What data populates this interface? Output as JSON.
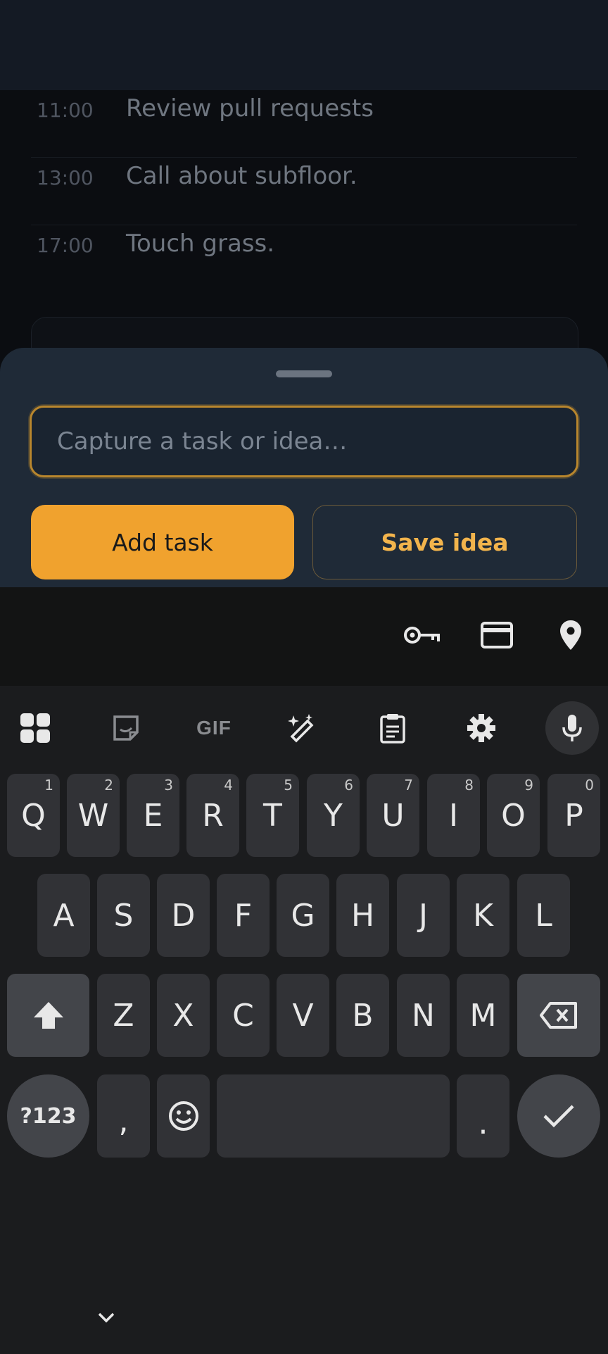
{
  "schedule": [
    {
      "time": "11:00",
      "text": "Review pull requests"
    },
    {
      "time": "13:00",
      "text": "Call about subfloor."
    },
    {
      "time": "17:00",
      "text": "Touch grass."
    }
  ],
  "sheet": {
    "capture_placeholder": "Capture a task or idea…",
    "capture_value": "",
    "add_label": "Add task",
    "save_label": "Save idea"
  },
  "keyboard": {
    "autofill_icons": [
      "key-icon",
      "credit-card-icon",
      "location-pin-icon"
    ],
    "toolbar_icons": [
      "apps-grid-icon",
      "sticker-icon",
      "gif-icon",
      "magic-edit-icon",
      "clipboard-icon",
      "settings-icon",
      "microphone-icon"
    ],
    "gif_label": "GIF",
    "row1": [
      {
        "k": "Q",
        "h": "1"
      },
      {
        "k": "W",
        "h": "2"
      },
      {
        "k": "E",
        "h": "3"
      },
      {
        "k": "R",
        "h": "4"
      },
      {
        "k": "T",
        "h": "5"
      },
      {
        "k": "Y",
        "h": "6"
      },
      {
        "k": "U",
        "h": "7"
      },
      {
        "k": "I",
        "h": "8"
      },
      {
        "k": "O",
        "h": "9"
      },
      {
        "k": "P",
        "h": "0"
      }
    ],
    "row2": [
      "A",
      "S",
      "D",
      "F",
      "G",
      "H",
      "J",
      "K",
      "L"
    ],
    "row3": [
      "Z",
      "X",
      "C",
      "V",
      "B",
      "N",
      "M"
    ],
    "symbols_label": "?123",
    "comma": ",",
    "period": "."
  }
}
